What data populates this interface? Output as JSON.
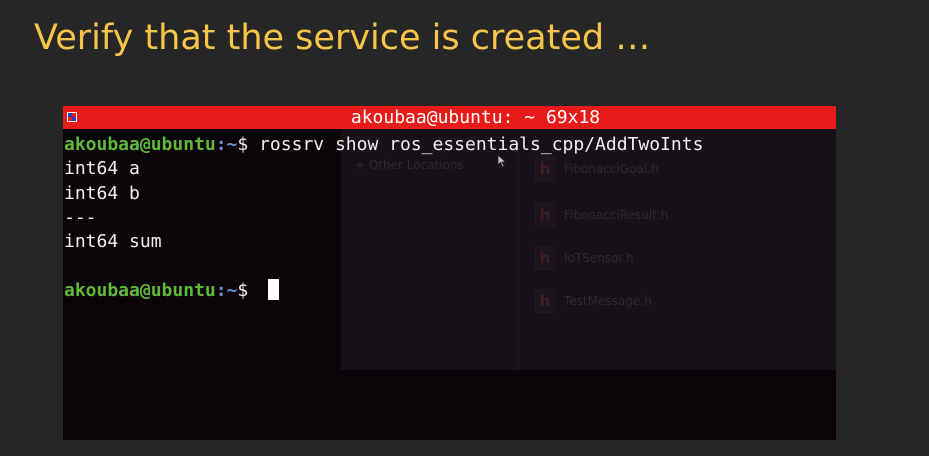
{
  "slide": {
    "title": "Verify that the service is created …"
  },
  "terminal": {
    "window_title": "akoubaa@ubuntu: ~ 69x18",
    "prompt_user_host": "akoubaa@ubuntu",
    "prompt_path": ":~",
    "prompt_symbol": "$ ",
    "command": "rossrv show ros_essentials_cpp/AddTwoInts",
    "output_lines": [
      "int64 a",
      "int64 b",
      "---",
      "int64 sum",
      ""
    ],
    "titlebar_color": "#e81b1b",
    "background_color": "#0b0509"
  },
  "background_window": {
    "location_label": "+ Other Locations",
    "file_icon_glyph": "h",
    "files": [
      "FibonacciGoal.h",
      "FibonacciResult.h",
      "IoTSensor.h",
      "TestMessage.h"
    ]
  },
  "colors": {
    "title": "#f7c548",
    "slide_background": "#262626",
    "prompt_user": "#5fb93a",
    "prompt_path": "#6a8fd0"
  }
}
